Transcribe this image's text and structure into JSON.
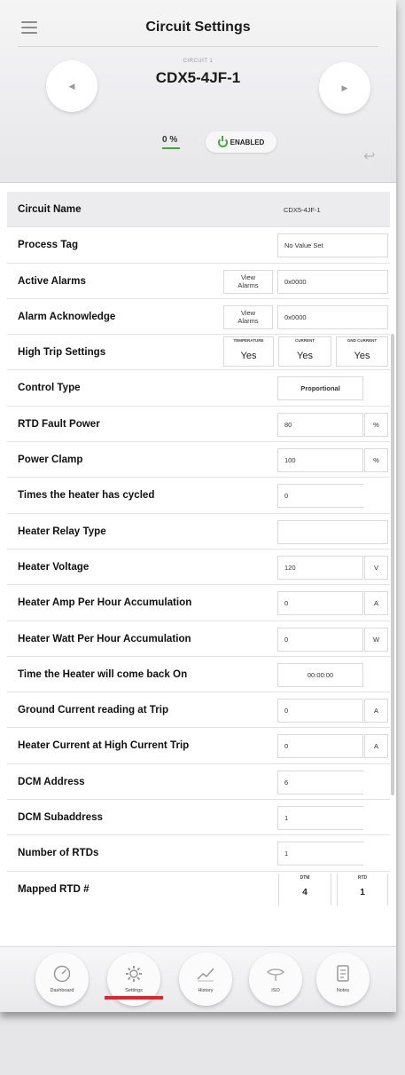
{
  "header": {
    "title": "Circuit Settings",
    "circuit_sub_label": "CIRCUIT 1",
    "circuit_name": "CDX5-4JF-1",
    "percent": "0 %",
    "status": "ENABLED"
  },
  "rows": [
    {
      "label": "Circuit Name",
      "value": "CDX5-4JF-1"
    },
    {
      "label": "Process Tag",
      "value": "No Value Set"
    },
    {
      "label": "Active Alarms",
      "button_line1": "View",
      "button_line2": "Alarms",
      "value": "0x0000"
    },
    {
      "label": "Alarm Acknowledge",
      "button_line1": "View",
      "button_line2": "Alarms",
      "value": "0x0000"
    },
    {
      "label": "High Trip Settings",
      "trips": [
        {
          "caption": "TEMPERATURE",
          "value": "Yes"
        },
        {
          "caption": "CURRENT",
          "value": "Yes"
        },
        {
          "caption": "GND CURRENT",
          "value": "Yes"
        }
      ]
    },
    {
      "label": "Control Type",
      "value": "Proportional"
    },
    {
      "label": "RTD Fault Power",
      "value": "80",
      "unit": "%"
    },
    {
      "label": "Power Clamp",
      "value": "100",
      "unit": "%"
    },
    {
      "label": "Times the heater has cycled",
      "value": "0"
    },
    {
      "label": "Heater Relay Type",
      "value": ""
    },
    {
      "label": "Heater Voltage",
      "value": "120",
      "unit": "V"
    },
    {
      "label": "Heater Amp Per Hour Accumulation",
      "value": "0",
      "unit": "A"
    },
    {
      "label": "Heater Watt Per Hour Accumulation",
      "value": "0",
      "unit": "W"
    },
    {
      "label": "Time the Heater will come back On",
      "value": "00:00:00"
    },
    {
      "label": "Ground Current reading at Trip",
      "value": "0",
      "unit": "A"
    },
    {
      "label": "Heater Current at High Current Trip",
      "value": "0",
      "unit": "A"
    },
    {
      "label": "DCM Address",
      "value": "6"
    },
    {
      "label": "DCM Subaddress",
      "value": "1"
    },
    {
      "label": "Number of RTDs",
      "value": "1"
    },
    {
      "label": "Mapped RTD #",
      "mapped": [
        {
          "caption": "DTM",
          "value": "4"
        },
        {
          "caption": "RTD",
          "value": "1"
        }
      ]
    }
  ],
  "tabs": [
    {
      "label": "Dashboard",
      "icon": "gauge-icon"
    },
    {
      "label": "Settings",
      "icon": "gear-icon"
    },
    {
      "label": "History",
      "icon": "chart-icon"
    },
    {
      "label": "ISO",
      "icon": "iso-icon"
    },
    {
      "label": "Notes",
      "icon": "notes-icon"
    }
  ],
  "colors": {
    "accent_red": "#e4232b",
    "enabled_green": "#39b03a"
  }
}
